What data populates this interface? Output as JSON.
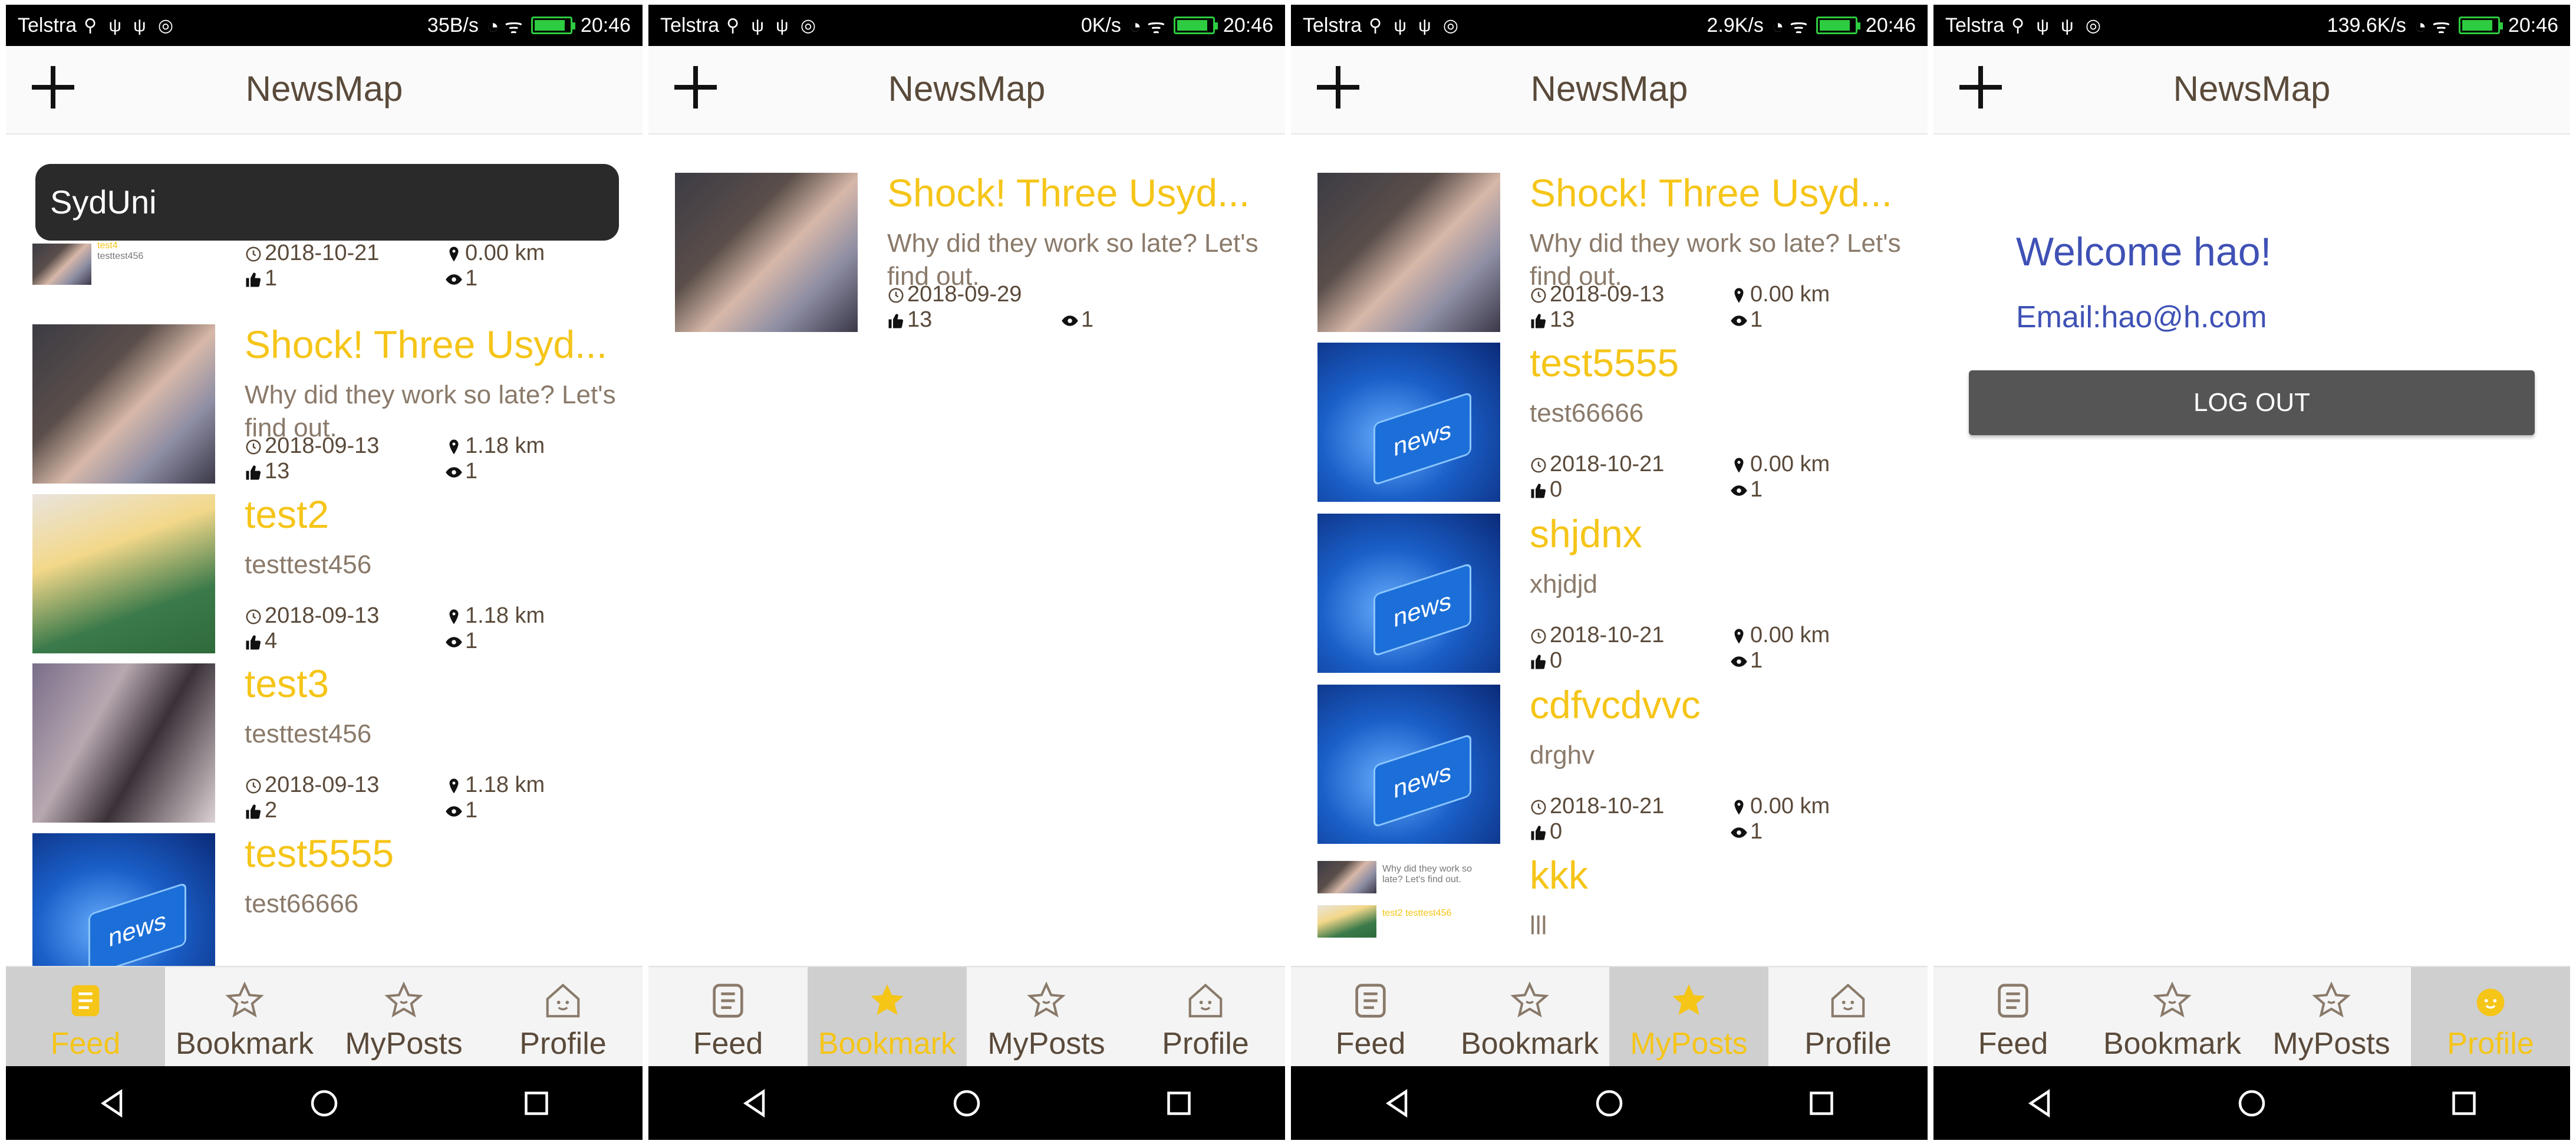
{
  "status_bars": [
    {
      "carrier": "Telstra",
      "speed": "35B/s",
      "time": "20:46"
    },
    {
      "carrier": "Telstra",
      "speed": "0K/s",
      "time": "20:46"
    },
    {
      "carrier": "Telstra",
      "speed": "2.9K/s",
      "time": "20:46"
    },
    {
      "carrier": "Telstra",
      "speed": "139.6K/s",
      "time": "20:46"
    }
  ],
  "app": {
    "title": "NewsMap"
  },
  "tabs": {
    "feed": "Feed",
    "bookmark": "Bookmark",
    "myposts": "MyPosts",
    "profile": "Profile"
  },
  "feed": {
    "search_text": "SydUni",
    "mini_item": {
      "title": "test4",
      "desc": "testtest456",
      "date": "2018-10-21",
      "distance": "0.00 km",
      "likes": "1",
      "views": "1"
    },
    "items": [
      {
        "title": "Shock! Three Usyd...",
        "desc": "Why did they work so late? Let's find out.",
        "date": "2018-09-13",
        "distance": "1.18 km",
        "likes": "13",
        "views": "1"
      },
      {
        "title": "test2",
        "desc": "testtest456",
        "date": "2018-09-13",
        "distance": "1.18 km",
        "likes": "4",
        "views": "1"
      },
      {
        "title": "test3",
        "desc": "testtest456",
        "date": "2018-09-13",
        "distance": "1.18 km",
        "likes": "2",
        "views": "1"
      },
      {
        "title": "test5555",
        "desc": "test66666"
      }
    ]
  },
  "bookmark": {
    "items": [
      {
        "title": "Shock! Three Usyd...",
        "desc": "Why did they work so late? Let's find out.",
        "date": "2018-09-29",
        "likes": "13",
        "views": "1"
      }
    ]
  },
  "myposts": {
    "items": [
      {
        "title": "Shock! Three Usyd...",
        "desc": "Why did they work so late? Let's find out.",
        "date": "2018-09-13",
        "distance": "0.00 km",
        "likes": "13",
        "views": "1"
      },
      {
        "title": "test5555",
        "desc": "test66666",
        "date": "2018-10-21",
        "distance": "0.00 km",
        "likes": "0",
        "views": "1"
      },
      {
        "title": "shjdnx",
        "desc": "xhjdjd",
        "date": "2018-10-21",
        "distance": "0.00 km",
        "likes": "0",
        "views": "1"
      },
      {
        "title": "cdfvcdvvc",
        "desc": "drghv",
        "date": "2018-10-21",
        "distance": "0.00 km",
        "likes": "0",
        "views": "1"
      },
      {
        "title": "kkk",
        "desc": "lll"
      }
    ],
    "mini_items": [
      {
        "text": "Why did they work so late? Let's find out."
      },
      {
        "text": "test2 testtest456"
      }
    ]
  },
  "profile": {
    "welcome": "Welcome hao!",
    "email": "Email:hao@h.com",
    "logout_label": "LOG OUT"
  },
  "thumbnail_label": "news",
  "colors": {
    "accent": "#f5c518",
    "profile_text": "#3f51b5",
    "tab_active_bg": "#cfcfcf"
  }
}
